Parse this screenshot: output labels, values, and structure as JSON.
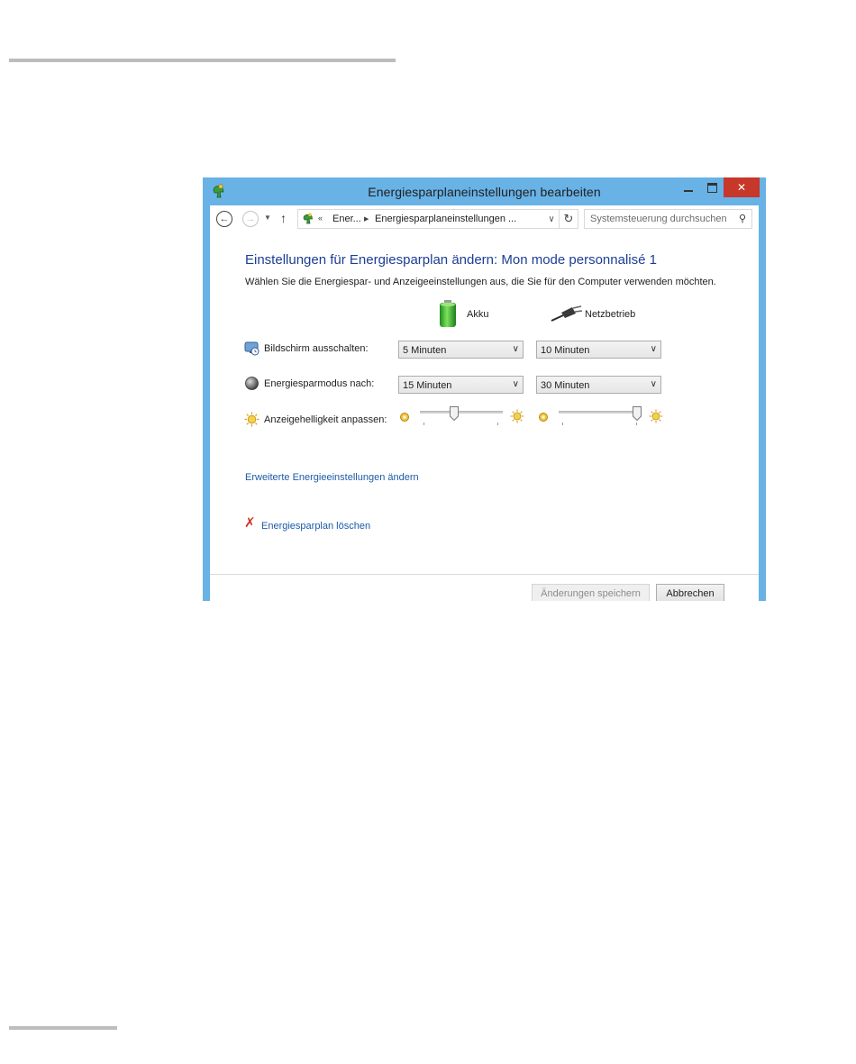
{
  "window": {
    "title": "Energiesparplaneinstellungen bearbeiten",
    "close_glyph": "✕"
  },
  "addressbar": {
    "back_glyph": "←",
    "forward_glyph": "→",
    "recent_glyph": "▼",
    "up_glyph": "↑",
    "overflow_glyph": "«",
    "crumb_1": "Ener...",
    "separator_glyph": "▶",
    "crumb_2": "Energiesparplaneinstellungen ...",
    "dropdown_glyph": "∨",
    "refresh_glyph": "↻",
    "search_placeholder": "Systemsteuerung durchsuchen",
    "search_glyph": "⚲"
  },
  "main": {
    "heading": "Einstellungen für Energiesparplan ändern: Mon mode personnalisé 1",
    "subtext": "Wählen Sie die Energiespar- und Anzeigeeinstellungen aus, die Sie für den Computer verwenden möchten.",
    "col_battery": "Akku",
    "col_plugged": "Netzbetrieb",
    "rows": {
      "display_off": {
        "label": "Bildschirm ausschalten:",
        "battery": "5 Minuten",
        "plugged": "10 Minuten"
      },
      "sleep": {
        "label": "Energiesparmodus nach:",
        "battery": "15 Minuten",
        "plugged": "30 Minuten"
      },
      "brightness": {
        "label": "Anzeigehelligkeit anpassen:",
        "battery_level": 0.4,
        "plugged_level": 1.0
      }
    },
    "select_arrow": "∨",
    "advanced_link": "Erweiterte Energieeinstellungen ändern",
    "delete_glyph": "✗",
    "delete_link": "Energiesparplan löschen"
  },
  "footer": {
    "save_label": "Änderungen speichern",
    "cancel_label": "Abbrechen"
  },
  "colors": {
    "titlebar": "#68b2e6",
    "close_button": "#c7372a",
    "heading": "#1c3e94",
    "link": "#1c5aa8",
    "delete_x": "#d4312a"
  }
}
